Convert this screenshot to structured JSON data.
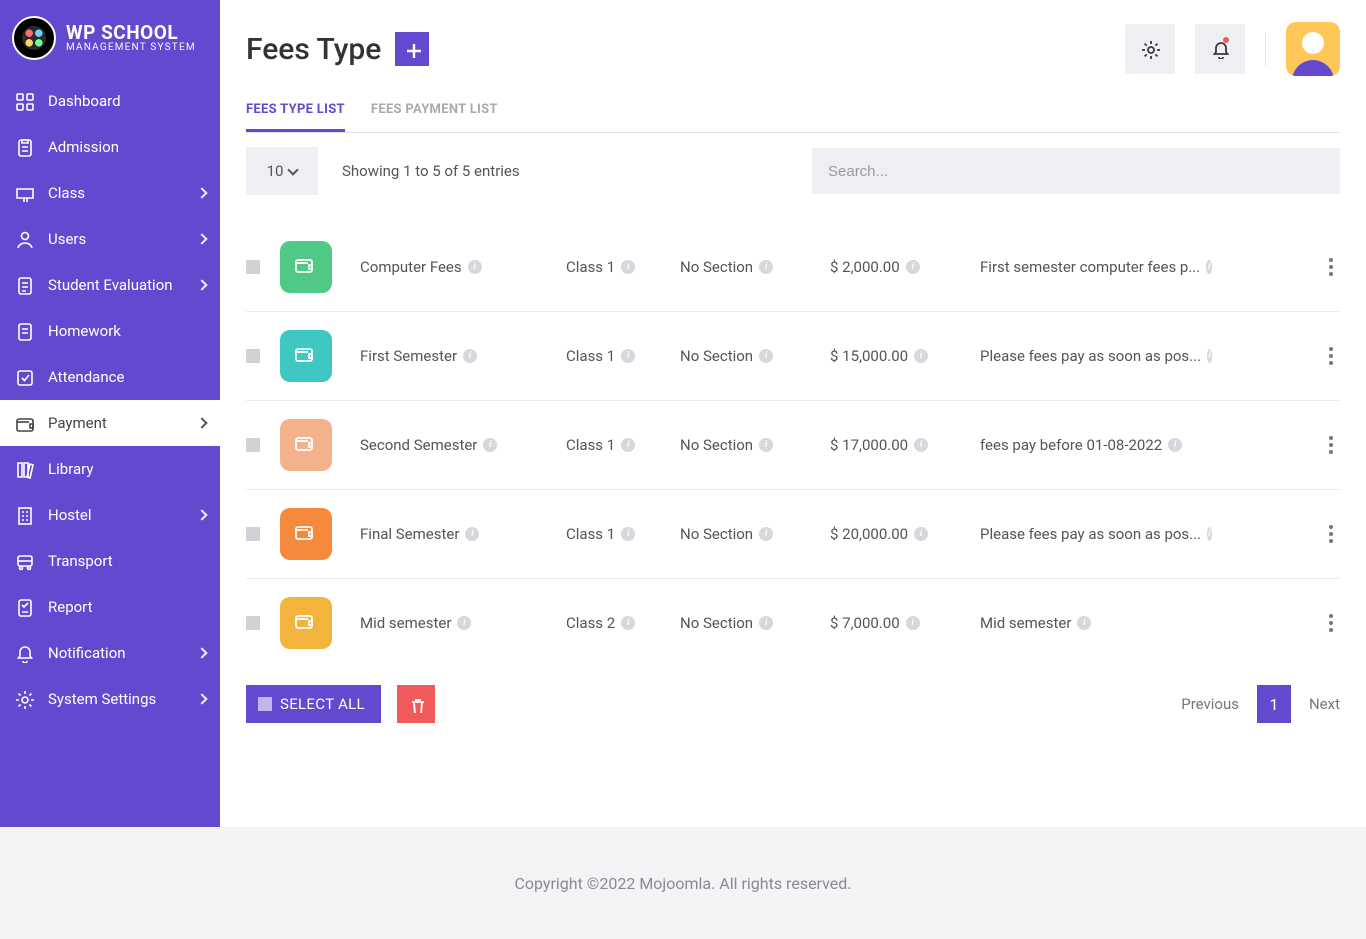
{
  "brand": {
    "line1": "WP SCHOOL",
    "line2": "MANAGEMENT SYSTEM"
  },
  "sidebar": {
    "items": [
      {
        "label": "Dashboard",
        "icon": "grid",
        "expandable": false
      },
      {
        "label": "Admission",
        "icon": "clipboard",
        "expandable": false
      },
      {
        "label": "Class",
        "icon": "classroom",
        "expandable": true
      },
      {
        "label": "Users",
        "icon": "user",
        "expandable": true
      },
      {
        "label": "Student Evaluation",
        "icon": "report",
        "expandable": true
      },
      {
        "label": "Homework",
        "icon": "document",
        "expandable": false
      },
      {
        "label": "Attendance",
        "icon": "check-square",
        "expandable": false
      },
      {
        "label": "Payment",
        "icon": "wallet",
        "expandable": true,
        "active": true
      },
      {
        "label": "Library",
        "icon": "books",
        "expandable": false
      },
      {
        "label": "Hostel",
        "icon": "building",
        "expandable": true
      },
      {
        "label": "Transport",
        "icon": "bus",
        "expandable": false
      },
      {
        "label": "Report",
        "icon": "survey",
        "expandable": false
      },
      {
        "label": "Notification",
        "icon": "bell",
        "expandable": true
      },
      {
        "label": "System Settings",
        "icon": "gear",
        "expandable": true
      }
    ]
  },
  "page": {
    "title": "Fees Type",
    "tabs": [
      {
        "label": "FEES TYPE LIST",
        "active": true
      },
      {
        "label": "FEES PAYMENT LIST",
        "active": false
      }
    ],
    "page_size": "10",
    "entries_text": "Showing 1 to 5 of 5 entries",
    "search_placeholder": "Search..."
  },
  "rows": [
    {
      "color": "#50c987",
      "name": "Computer Fees",
      "class": "Class 1",
      "section": "No Section",
      "amount": "$ 2,000.00",
      "desc": "First semester computer fees p..."
    },
    {
      "color": "#3ec7c3",
      "name": "First Semester",
      "class": "Class 1",
      "section": "No Section",
      "amount": "$ 15,000.00",
      "desc": "Please fees pay as soon as pos..."
    },
    {
      "color": "#f3b18c",
      "name": "Second Semester",
      "class": "Class 1",
      "section": "No Section",
      "amount": "$ 17,000.00",
      "desc": "fees pay before 01-08-2022"
    },
    {
      "color": "#f68a3c",
      "name": "Final Semester",
      "class": "Class 1",
      "section": "No Section",
      "amount": "$ 20,000.00",
      "desc": "Please fees pay as soon as pos..."
    },
    {
      "color": "#f2b43d",
      "name": "Mid semester",
      "class": "Class 2",
      "section": "No Section",
      "amount": "$ 7,000.00",
      "desc": "Mid semester"
    }
  ],
  "bottom": {
    "select_all": "SELECT ALL",
    "prev": "Previous",
    "page": "1",
    "next": "Next"
  },
  "footer": "Copyright ©2022 Mojoomla. All rights reserved."
}
